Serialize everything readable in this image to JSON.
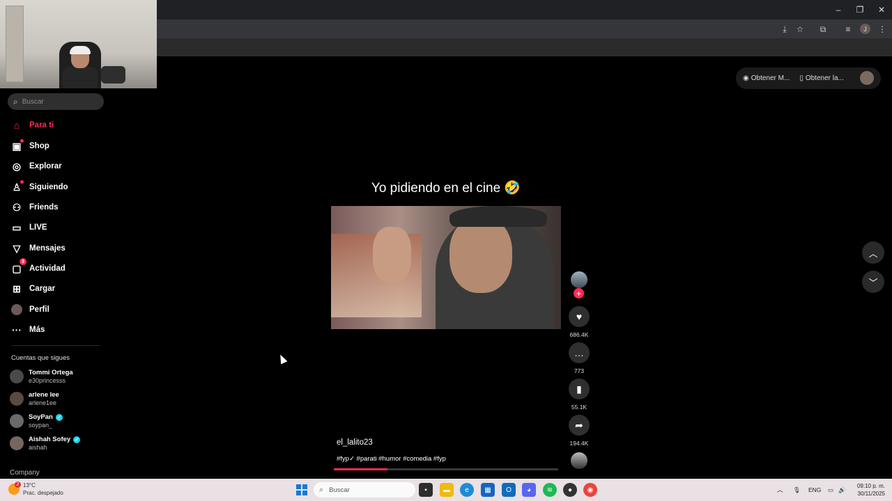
{
  "browser": {
    "window_controls": [
      "–",
      "❐",
      "✕"
    ],
    "profile_initial": "J"
  },
  "search": {
    "placeholder": "Buscar"
  },
  "nav": [
    {
      "label": "Para ti",
      "icon": "home-icon",
      "active": true
    },
    {
      "label": "Shop",
      "icon": "shopping-bag-icon"
    },
    {
      "label": "Explorar",
      "icon": "compass-icon"
    },
    {
      "label": "Siguiendo",
      "icon": "user-follow-icon"
    },
    {
      "label": "Friends",
      "icon": "friends-icon"
    },
    {
      "label": "LIVE",
      "icon": "live-tv-icon"
    },
    {
      "label": "Mensajes",
      "icon": "send-icon"
    },
    {
      "label": "Actividad",
      "icon": "activity-icon",
      "badge": "3"
    },
    {
      "label": "Cargar",
      "icon": "upload-icon"
    },
    {
      "label": "Perfil",
      "icon": "profile-avatar"
    },
    {
      "label": "Más",
      "icon": "more-icon"
    }
  ],
  "following": {
    "title": "Cuentas que sigues",
    "accounts": [
      {
        "name": "Tommi Ortega",
        "username": "e30princesss"
      },
      {
        "name": "arlene lee",
        "username": "arlene1ee"
      },
      {
        "name": "SoyPan",
        "username": "soypan_",
        "verified": true
      },
      {
        "name": "Aishah Sofey",
        "username": "aishah",
        "verified": true
      }
    ]
  },
  "footer": {
    "company": "Company"
  },
  "top_actions": {
    "coins": "Obtener M...",
    "app": "Obtener la..."
  },
  "video": {
    "caption": "Yo pidiendo en el cine 🤣",
    "author": "el_lalito23",
    "hashtags": "#fyp✓ #parati #humor #comedia #fyp",
    "progress": 0.24
  },
  "engagement": {
    "likes": "686.4K",
    "comments": "773",
    "saves": "55.1K",
    "shares": "194.4K"
  },
  "taskbar": {
    "temperature": "13°C",
    "weather": "Prac. despejado",
    "weather_badge": "2",
    "search": "Buscar",
    "language": "ENG",
    "time": "09:10 p. m.",
    "date": "30/11/2025"
  },
  "colors": {
    "accent": "#fe2c55",
    "verified": "#20d5ec"
  }
}
